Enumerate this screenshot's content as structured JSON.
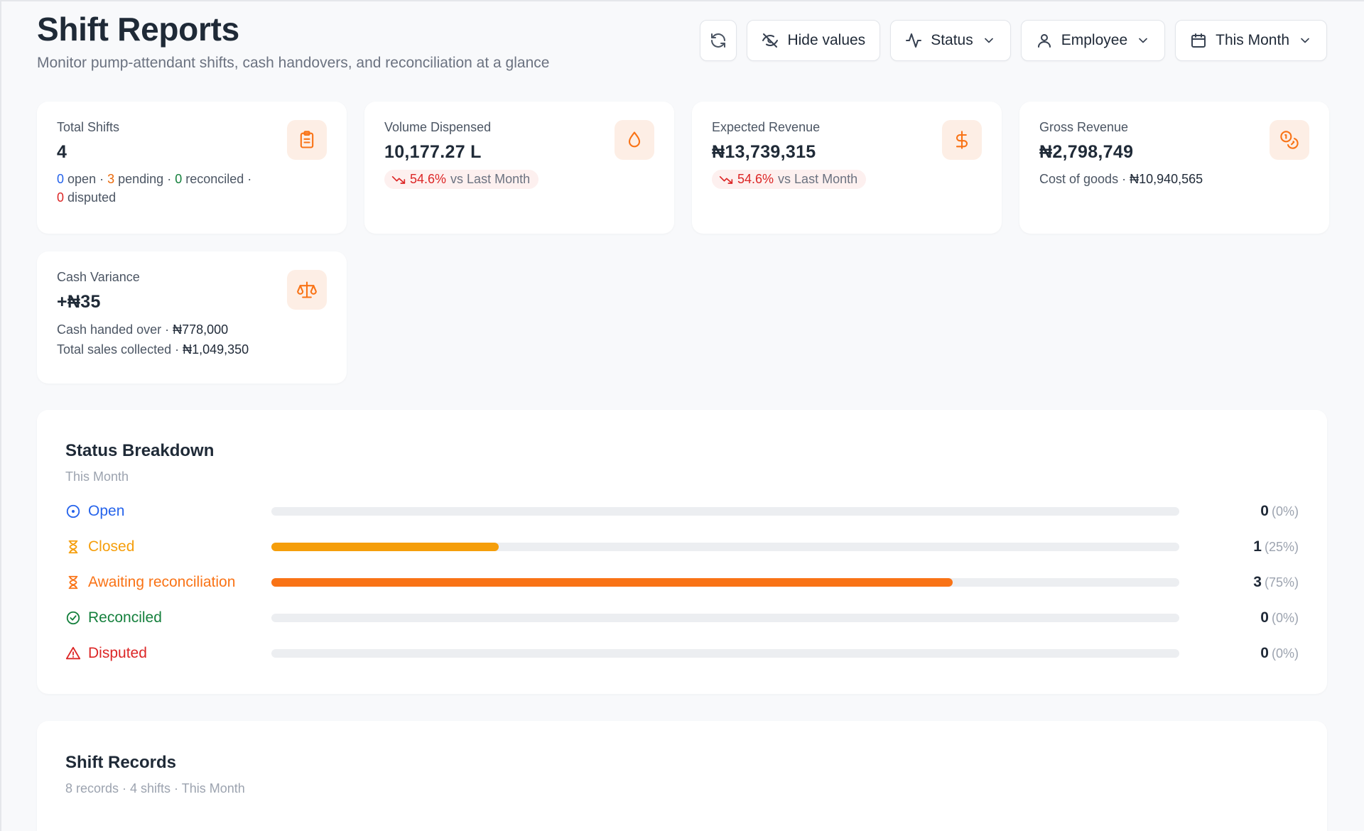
{
  "header": {
    "title": "Shift Reports",
    "subtitle": "Monitor pump-attendant shifts, cash handovers, and reconciliation at a glance"
  },
  "toolbar": {
    "refresh_icon": "refresh-icon",
    "hide_values_label": "Hide values",
    "status_label": "Status",
    "employee_label": "Employee",
    "period_label": "This Month"
  },
  "stats": {
    "total_shifts": {
      "label": "Total Shifts",
      "value": "4",
      "open_count": "0",
      "open_label": "open",
      "pending_count": "3",
      "pending_label": "pending",
      "reconciled_count": "0",
      "reconciled_label": "reconciled",
      "disputed_count": "0",
      "disputed_label": "disputed",
      "icon": "clipboard-icon"
    },
    "volume": {
      "label": "Volume Dispensed",
      "value": "10,177.27 L",
      "trend_pct": "54.6%",
      "trend_text": "vs Last Month",
      "icon": "droplet-icon"
    },
    "expected_revenue": {
      "label": "Expected Revenue",
      "value": "₦13,739,315",
      "trend_pct": "54.6%",
      "trend_text": "vs Last Month",
      "icon": "dollar-icon"
    },
    "gross_revenue": {
      "label": "Gross Revenue",
      "value": "₦2,798,749",
      "sub_label": "Cost of goods ·",
      "sub_value": "₦10,940,565",
      "icon": "coins-icon"
    },
    "cash_variance": {
      "label": "Cash Variance",
      "value": "+₦35",
      "handed_label": "Cash handed over ·",
      "handed_value": "₦778,000",
      "collected_label": "Total sales collected ·",
      "collected_value": "₦1,049,350",
      "icon": "scale-icon"
    }
  },
  "status_breakdown": {
    "title": "Status Breakdown",
    "subtitle": "This Month",
    "rows": [
      {
        "label": "Open",
        "count": "0",
        "pct": "(0%)",
        "fraction": 0,
        "color": "#2563eb",
        "icon": "clock-icon"
      },
      {
        "label": "Closed",
        "count": "1",
        "pct": "(25%)",
        "fraction": 0.25,
        "color": "#f59e0b",
        "icon": "hourglass-icon"
      },
      {
        "label": "Awaiting reconciliation",
        "count": "3",
        "pct": "(75%)",
        "fraction": 0.75,
        "color": "#f97316",
        "icon": "hourglass-icon"
      },
      {
        "label": "Reconciled",
        "count": "0",
        "pct": "(0%)",
        "fraction": 0,
        "color": "#15803d",
        "icon": "check-circle-icon"
      },
      {
        "label": "Disputed",
        "count": "0",
        "pct": "(0%)",
        "fraction": 0,
        "color": "#dc2626",
        "icon": "alert-triangle-icon"
      }
    ]
  },
  "shift_records": {
    "title": "Shift Records",
    "subtitle": "8 records · 4 shifts · This Month"
  },
  "colors": {
    "accent": "#f97316",
    "accent_bg": "#fdeee5",
    "blue": "#2563eb",
    "green": "#15803d",
    "red": "#dc2626"
  }
}
